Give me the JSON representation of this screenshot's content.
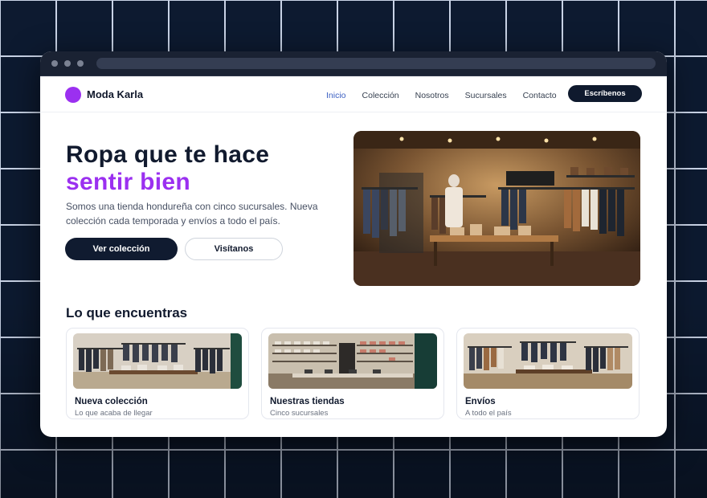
{
  "brand": {
    "name": "Moda Karla",
    "color": "#9b30f0"
  },
  "nav": {
    "items": [
      {
        "label": "Inicio",
        "active": true
      },
      {
        "label": "Colección",
        "active": false
      },
      {
        "label": "Nosotros",
        "active": false
      },
      {
        "label": "Sucursales",
        "active": false
      },
      {
        "label": "Contacto",
        "active": false
      }
    ],
    "cta_label": "Escríbenos"
  },
  "hero": {
    "title_line1": "Ropa que te hace",
    "title_line2": "sentir bien",
    "description": "Somos una tienda hondureña con cinco sucursales. Nueva colección cada temporada y envíos a todo el país.",
    "primary_button": "Ver colección",
    "secondary_button": "Visítanos",
    "accent_color": "#9b30f0"
  },
  "section": {
    "title": "Lo que encuentras",
    "cards": [
      {
        "title": "Nueva colección",
        "subtitle": "Lo que acaba de llegar"
      },
      {
        "title": "Nuestras tiendas",
        "subtitle": "Cinco sucursales"
      },
      {
        "title": "Envíos",
        "subtitle": "A todo el país"
      }
    ]
  }
}
